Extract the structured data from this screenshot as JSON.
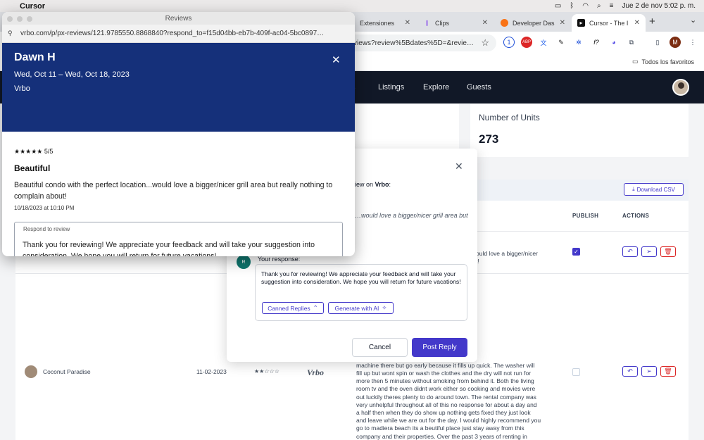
{
  "menubar": {
    "app_name": "Cursor",
    "datetime": "Jue 2 de nov  5:02 p. m."
  },
  "browser": {
    "tabs": [
      {
        "label": "Extensiones"
      },
      {
        "label": "Clips"
      },
      {
        "label": "Developer Das"
      },
      {
        "label": "Cursor - The I"
      }
    ],
    "url_partial": "views?review%5Bdates%5D=&revie…",
    "bookmarks_label": "Todos los favoritos",
    "profile_initial": "M"
  },
  "site": {
    "nav": [
      "ts",
      "Listings",
      "Explore",
      "Guests"
    ],
    "units_label": "Number of Units",
    "units_value": "273",
    "download_csv": "Download CSV",
    "columns": {
      "publish": "PUBLISH",
      "actions": "ACTIONS"
    },
    "row1_snippet": "ould love a bigger/nicer\nt!",
    "row2": {
      "guest": "Coconut Paradise",
      "date": "11-02-2023",
      "stars": "★★☆☆☆",
      "source_logo": "Vrbo",
      "review_lines": [
        "ppearences but as we",
        "looks can be deceiving.",
        "eed to be addressed the",
        "y we noticed that both",
        "ull them open but the",
        "back and completly close",
        "move on to the",
        "operate properly so you",
        "eet and try to snag a",
        "machine there but go early because it fills up quick. The washer will",
        "fill up but wont spin or wash the clothes and the dry will not run for",
        "more then 5 minutes without smoking from behind it. Both the living",
        "room tv and the oven didnt work either so cooking and movies were",
        "out luckily theres plenty to do around town. The rental company was",
        "very unhelpful throughout all of this no response for about a day and",
        "a half then when they do show up nothing gets fixed they just look",
        "and leave while we are out for the day. I would highly recommend you",
        "go to madiera beach its a beutiful place just stay away from this",
        "company and their properties. Over the past 3 years of renting in"
      ]
    },
    "modal": {
      "partial_intro_pre": "iew on ",
      "partial_intro_source": "Vrbo",
      "partial_intro_post": ":",
      "partial_review": "…would love a bigger/nicer grill area but",
      "your_response_label": "Your response:",
      "avatar_initials": "R",
      "response_text": "Thank you for reviewing! We appreciate your feedback and will take your suggestion into consideration. We hope you will return for future vacations!",
      "canned_replies": "Canned Replies",
      "generate_ai": "Generate with AI",
      "cancel": "Cancel",
      "post_reply": "Post Reply"
    }
  },
  "popup": {
    "window_title": "Reviews",
    "url": "vrbo.com/p/px-reviews/121.9785550.8868840?respond_to=f15d04bb-eb7b-409f-ac04-5bc0897…",
    "guest_name": "Dawn H",
    "dates": "Wed, Oct 11 – Wed, Oct 18, 2023",
    "source": "Vrbo",
    "stars": "★★★★★",
    "rating": "5/5",
    "review_title": "Beautiful",
    "review_body": "Beautiful condo with the perfect location...would love a bigger/nicer grill area but really nothing to complain about!",
    "review_date": "10/18/2023 at 10:10 PM",
    "respond_label": "Respond to review",
    "respond_text": "Thank you for reviewing! We appreciate your feedback and will take your suggestion into consideration. We hope you will return for future vacations!"
  }
}
